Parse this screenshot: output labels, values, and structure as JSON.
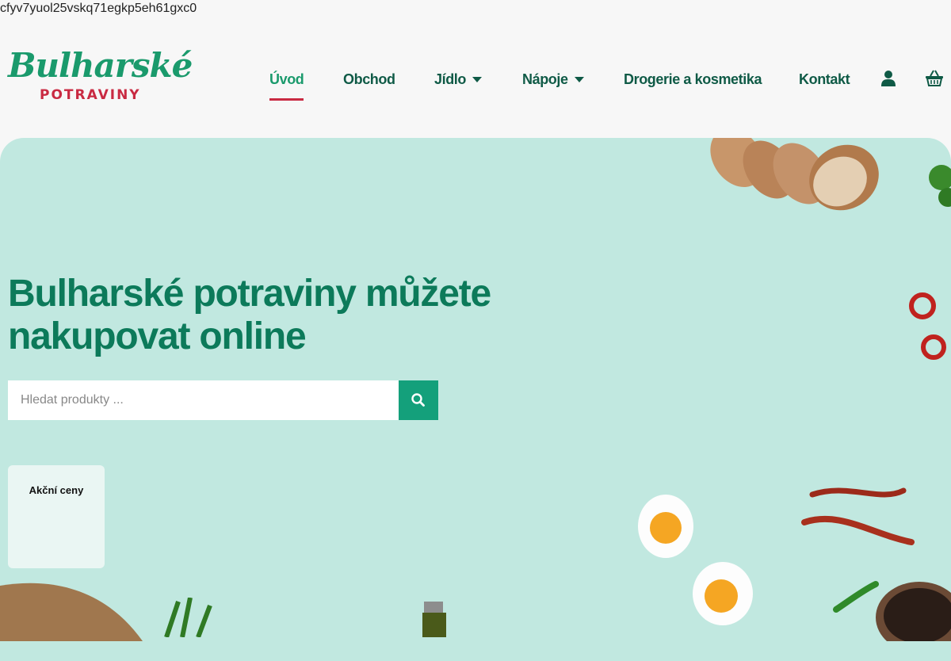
{
  "page_id": "cfyv7yuol25vskq71egkp5eh61gxc0",
  "logo": {
    "script": "Bulharské",
    "sub": "POTRAVINY"
  },
  "nav": {
    "items": [
      {
        "label": "Úvod"
      },
      {
        "label": "Obchod"
      },
      {
        "label": "Jídlo"
      },
      {
        "label": "Nápoje"
      },
      {
        "label": "Drogerie a kosmetika"
      },
      {
        "label": "Kontakt"
      }
    ],
    "active": "Úvod",
    "icons": [
      "user-icon",
      "shopping-basket-icon"
    ]
  },
  "hero": {
    "title": "Bulharské potraviny můžete nakupovat online",
    "search": {
      "placeholder": "Hledat produkty ...",
      "value": ""
    },
    "promo_card": {
      "label": "Akční ceny"
    }
  },
  "colors": {
    "brand_green": "#1a9a6c",
    "nav_text": "#0f5a46",
    "accent_red": "#c92a42",
    "hero_bg": "#c1e8e0",
    "search_button": "#14a07b"
  }
}
